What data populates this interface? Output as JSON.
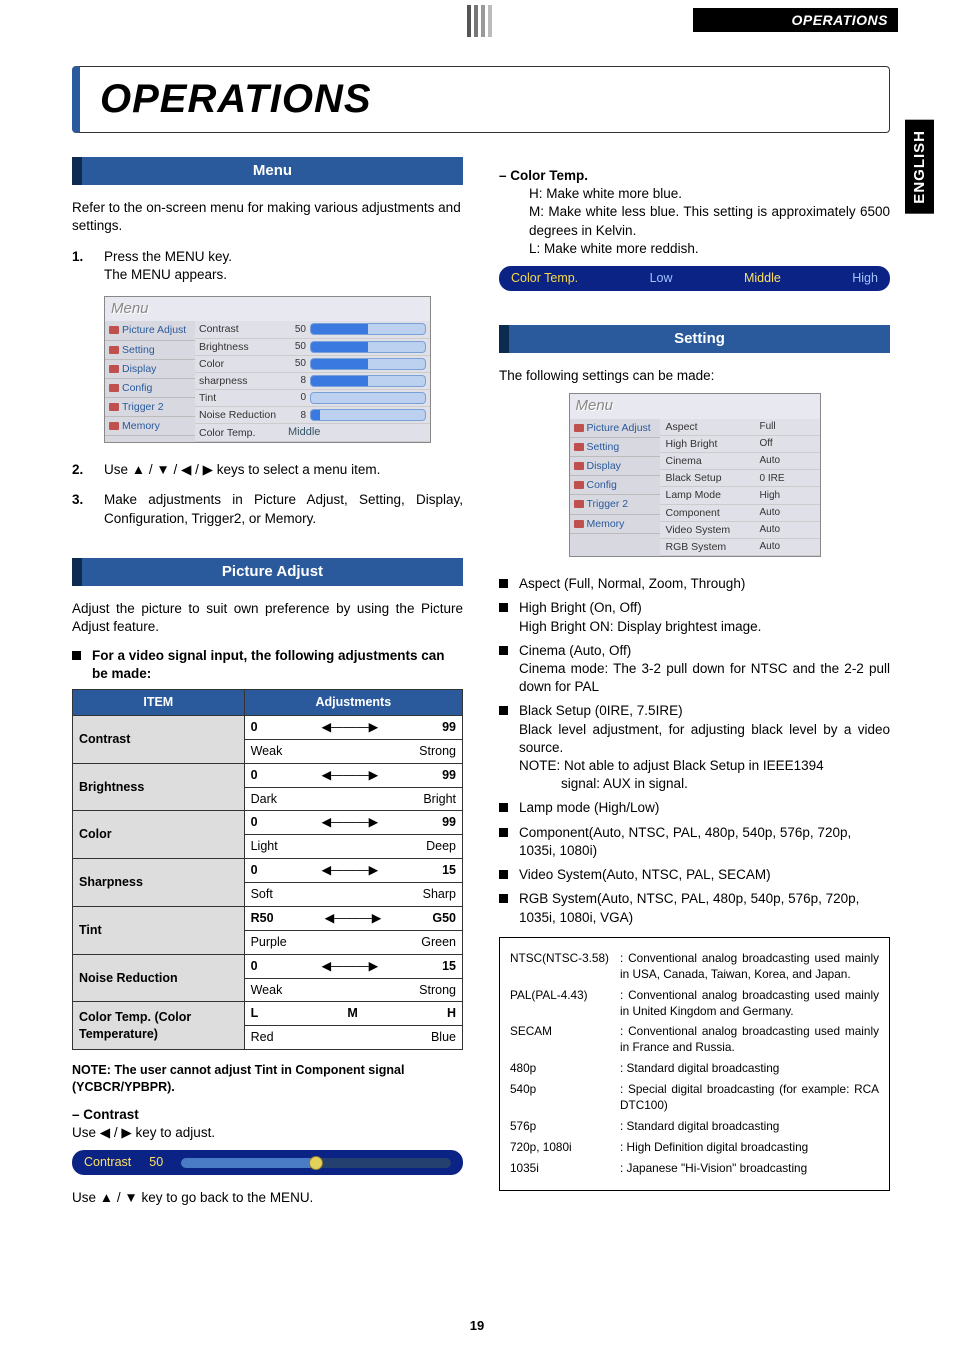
{
  "runhead": "OPERATIONS",
  "language_tab": "ENGLISH",
  "doc_title": "OPERATIONS",
  "page_number": "19",
  "left": {
    "section_menu": "Menu",
    "menu_intro": "Refer to the on-screen menu for making various adjustments and settings.",
    "step1_num": "1.",
    "step1_a": "Press the MENU key.",
    "step1_b": "The MENU appears.",
    "step2_num": "2.",
    "step2": "Use ▲ / ▼ / ◀ / ▶ keys to select a menu item.",
    "step3_num": "3.",
    "step3": "Make adjustments in Picture Adjust, Setting, Display, Configuration, Trigger2, or Memory.",
    "section_pa": "Picture Adjust",
    "pa_intro": "Adjust the picture to suit own preference by using the Picture Adjust feature.",
    "pa_sub": "For a video signal input, the following adjustments can be made:",
    "adj_table": {
      "h_item": "ITEM",
      "h_adj": "Adjustments",
      "rows": [
        {
          "name": "Contrast",
          "lo": "0",
          "hi": "99",
          "lo_lbl": "Weak",
          "hi_lbl": "Strong"
        },
        {
          "name": "Brightness",
          "lo": "0",
          "hi": "99",
          "lo_lbl": "Dark",
          "hi_lbl": "Bright"
        },
        {
          "name": "Color",
          "lo": "0",
          "hi": "99",
          "lo_lbl": "Light",
          "hi_lbl": "Deep"
        },
        {
          "name": "Sharpness",
          "lo": "0",
          "hi": "15",
          "lo_lbl": "Soft",
          "hi_lbl": "Sharp"
        },
        {
          "name": "Tint",
          "lo": "R50",
          "hi": "G50",
          "lo_lbl": "Purple",
          "hi_lbl": "Green"
        },
        {
          "name": "Noise Reduction",
          "lo": "0",
          "hi": "15",
          "lo_lbl": "Weak",
          "hi_lbl": "Strong"
        },
        {
          "name": "Color Temp. (Color Temperature)",
          "lo": "L",
          "mid": "M",
          "hi": "H",
          "lo_lbl": "Red",
          "hi_lbl": "Blue"
        }
      ]
    },
    "pa_note": "NOTE: The user cannot adjust Tint in Component signal (YCBCR/YPBPR).",
    "contrast_head": "– Contrast",
    "contrast_use": "Use ◀ / ▶ key to adjust.",
    "contrast_osd": {
      "label": "Contrast",
      "value": "50"
    },
    "back_to_menu": "Use ▲ / ▼ key to go back to the MENU.",
    "osd_menu_title": "Menu",
    "osd_side": [
      "Picture Adjust",
      "Setting",
      "Display",
      "Config",
      "Trigger 2",
      "Memory"
    ],
    "osd_rows": [
      {
        "lbl": "Contrast",
        "val": "50",
        "barclass": "bar"
      },
      {
        "lbl": "Brightness",
        "val": "50",
        "barclass": "bar"
      },
      {
        "lbl": "Color",
        "val": "50",
        "barclass": "bar"
      },
      {
        "lbl": "sharpness",
        "val": "8",
        "barclass": "bar"
      },
      {
        "lbl": "Tint",
        "val": "0",
        "barclass": "bar0"
      },
      {
        "lbl": "Noise Reduction",
        "val": "8",
        "barclass": "bar8"
      },
      {
        "lbl": "Color Temp.",
        "txt": "Middle"
      }
    ]
  },
  "right": {
    "ct_head": "– Color Temp.",
    "ct_h": "H:  Make white more blue.",
    "ct_m": "M:  Make white less blue. This setting is approximately 6500 degrees in Kelvin.",
    "ct_l": "L:  Make white more reddish.",
    "ct_strip": {
      "label": "Color Temp.",
      "low": "Low",
      "mid": "Middle",
      "high": "High"
    },
    "section_setting": "Setting",
    "setting_intro": "The following settings can be made:",
    "osd_setting_title": "Menu",
    "osd_setting_side": [
      "Picture Adjust",
      "Setting",
      "Display",
      "Config",
      "Trigger 2",
      "Memory"
    ],
    "osd_setting_rows": [
      {
        "lbl": "Aspect",
        "val": "Full"
      },
      {
        "lbl": "High Bright",
        "val": "Off"
      },
      {
        "lbl": "Cinema",
        "val": "Auto"
      },
      {
        "lbl": "Black Setup",
        "val": "0 IRE"
      },
      {
        "lbl": "Lamp Mode",
        "val": "High"
      },
      {
        "lbl": "Component",
        "val": "Auto"
      },
      {
        "lbl": "Video System",
        "val": "Auto"
      },
      {
        "lbl": "RGB System",
        "val": "Auto"
      }
    ],
    "bullets": {
      "aspect": "Aspect (Full, Normal, Zoom, Through)",
      "high_bright": "High Bright (On, Off)",
      "high_bright_note": "High Bright ON: Display brightest image.",
      "cinema": "Cinema (Auto, Off)",
      "cinema_note": "Cinema mode: The 3-2 pull down for NTSC and the 2-2 pull down for PAL",
      "black": "Black Setup (0IRE, 7.5IRE)",
      "black_note1": "Black level adjustment, for adjusting black level by a video source.",
      "black_note2a": "NOTE: Not able to adjust Black Setup in IEEE1394",
      "black_note2b": "signal: AUX in signal.",
      "lamp": "Lamp mode (High/Low)",
      "component": "Component(Auto, NTSC, PAL, 480p, 540p, 576p, 720p, 1035i, 1080i)",
      "video": "Video System(Auto, NTSC, PAL, SECAM)",
      "rgb": "RGB System(Auto, NTSC, PAL, 480p, 540p, 576p, 720p, 1035i, 1080i, VGA)"
    },
    "info_rows": [
      {
        "k": "NTSC(NTSC-3.58)",
        "v": ": Conventional analog broadcasting used mainly in USA, Canada, Taiwan, Korea, and Japan."
      },
      {
        "k": "PAL(PAL-4.43)",
        "v": ": Conventional analog broadcasting used mainly in United Kingdom and Germany."
      },
      {
        "k": "SECAM",
        "v": ": Conventional analog broadcasting used mainly in France and Russia."
      },
      {
        "k": "480p",
        "v": ": Standard digital broadcasting"
      },
      {
        "k": "540p",
        "v": ": Special digital broadcasting (for example: RCA DTC100)"
      },
      {
        "k": "576p",
        "v": ": Standard digital broadcasting"
      },
      {
        "k": "720p, 1080i",
        "v": ": High Definition digital broadcasting"
      },
      {
        "k": "1035i",
        "v": ": Japanese \"Hi-Vision\" broadcasting"
      }
    ]
  }
}
